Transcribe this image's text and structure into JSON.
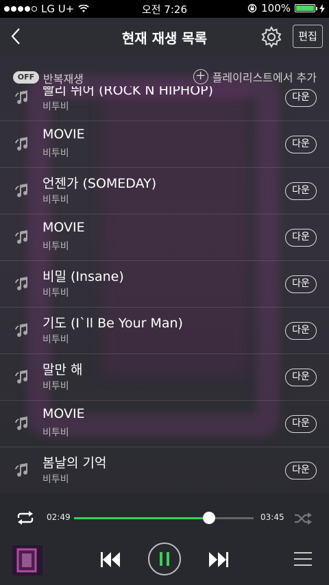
{
  "status_bar": {
    "carrier": "LG U+",
    "time": "오전 7:26",
    "battery": "100%"
  },
  "header": {
    "title": "현재 재생 목록",
    "edit_label": "편집"
  },
  "options": {
    "toggle_label": "OFF",
    "repeat_label": "반복재생",
    "add_playlist_label": "플레이리스트에서 추가"
  },
  "playlist": [
    {
      "title": "빨리 뛰어 (ROCK N HIPHOP)",
      "artist": "비투비",
      "download_label": "다운"
    },
    {
      "title": "MOVIE",
      "artist": "비투비",
      "download_label": "다운"
    },
    {
      "title": "언젠가 (SOMEDAY)",
      "artist": "비투비",
      "download_label": "다운"
    },
    {
      "title": "MOVIE",
      "artist": "비투비",
      "download_label": "다운"
    },
    {
      "title": "비밀 (Insane)",
      "artist": "비투비",
      "download_label": "다운"
    },
    {
      "title": "기도 (I`ll Be Your Man)",
      "artist": "비투비",
      "download_label": "다운"
    },
    {
      "title": "말만 해",
      "artist": "비투비",
      "download_label": "다운"
    },
    {
      "title": "MOVIE",
      "artist": "비투비",
      "download_label": "다운"
    },
    {
      "title": "봄날의 기억",
      "artist": "비투비",
      "download_label": "다운"
    }
  ],
  "player": {
    "current_time": "02:49",
    "total_time": "03:45",
    "progress": 0.75
  },
  "colors": {
    "accent": "#3ad154",
    "background": "#2b2d33",
    "battery": "#4cd964"
  }
}
